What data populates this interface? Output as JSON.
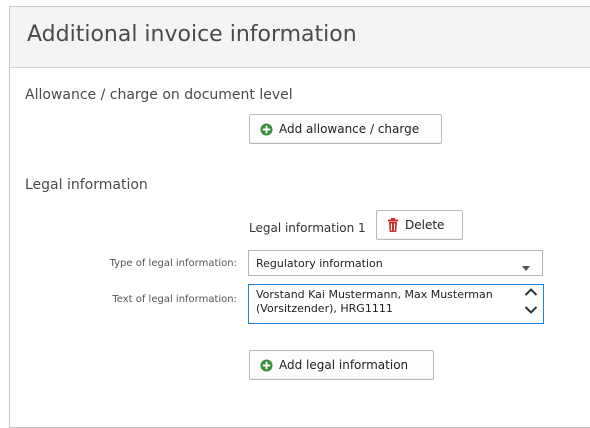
{
  "panel": {
    "title": "Additional invoice information"
  },
  "allowance_section": {
    "title": "Allowance / charge on document level",
    "add_button_label": "Add allowance / charge"
  },
  "legal_section": {
    "title": "Legal information",
    "entry_label": "Legal information 1",
    "delete_button_label": "Delete",
    "type_label": "Type of legal information:",
    "type_value": "Regulatory information",
    "text_label": "Text of legal information:",
    "text_value": "Vorstand Kai Mustermann, Max Musterman (Vorsitzender), HRG1111",
    "add_button_label": "Add legal information"
  },
  "colors": {
    "add_icon": "#3c8d3c",
    "delete_icon": "#c9302c",
    "focus_border": "#1e88d6"
  },
  "icons": {
    "add": "plus-circle-icon",
    "delete": "trash-icon",
    "dropdown": "caret-down-icon",
    "scroll_up": "chevron-up-icon",
    "scroll_down": "chevron-down-icon"
  }
}
